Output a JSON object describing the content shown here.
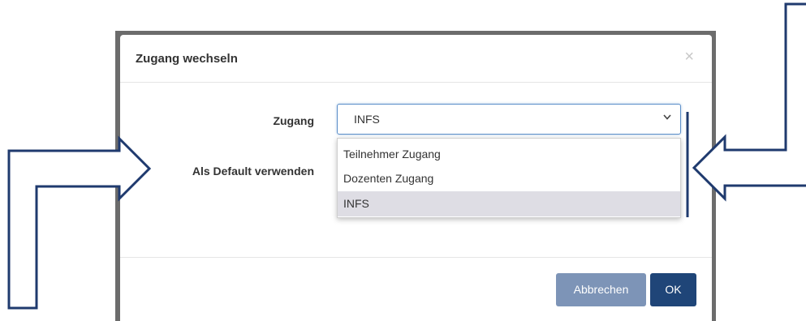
{
  "dialog": {
    "title": "Zugang wechseln",
    "close_glyph": "×"
  },
  "form": {
    "zugang_label": "Zugang",
    "default_label": "Als Default verwenden",
    "selected_value": "INFS",
    "options": [
      "Teilnehmer Zugang",
      "Dozenten Zugang",
      "INFS"
    ],
    "highlighted_option_index": 2
  },
  "footer": {
    "cancel_label": "Abbrechen",
    "ok_label": "OK"
  },
  "icons": {
    "close": "close-icon",
    "chevron": "chevron-down-icon"
  },
  "colors": {
    "primary": "#1f4578",
    "secondary": "#7d94b7",
    "annotation_arrows": "#1f3a6e",
    "select_focus": "#5b8ec9",
    "option_highlight": "#dedde4"
  }
}
